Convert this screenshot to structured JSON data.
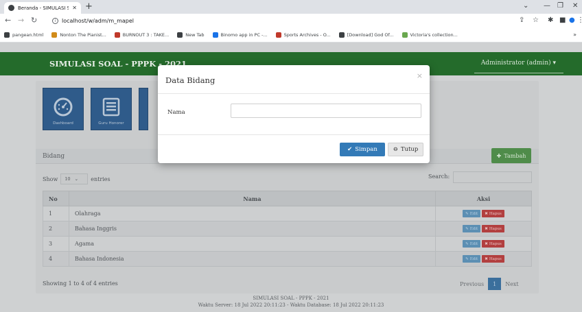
{
  "browser": {
    "tab_title": "Beranda - SIMULASI SOAL - PPPK",
    "new_tab_label": "+",
    "url": "localhost/w/adm/m_mapel",
    "bookmarks": [
      {
        "label": "pangean.html",
        "icon": "globe-icon",
        "color": "#3c4043"
      },
      {
        "label": "Nonton The Pianist...",
        "icon": "film-icon",
        "color": "#d18b1a"
      },
      {
        "label": "BURNOUT 3 : TAKE...",
        "icon": "game-icon",
        "color": "#c0392b"
      },
      {
        "label": "New Tab",
        "icon": "globe-icon",
        "color": "#3c4043"
      },
      {
        "label": "Binomo app in PC -...",
        "icon": "binomo-icon",
        "color": "#1a73e8"
      },
      {
        "label": "Sports Archives - O...",
        "icon": "gamepad-icon",
        "color": "#c0392b"
      },
      {
        "label": "[Download] God Of...",
        "icon": "globe-icon",
        "color": "#3c4043"
      },
      {
        "label": "Victoria's collection...",
        "icon": "leaf-icon",
        "color": "#6aa84f"
      }
    ],
    "more_label": "»"
  },
  "navbar": {
    "brand": "SIMULASI SOAL - PPPK - 2021",
    "user": "Administrator (admin) ▾"
  },
  "quicklinks": [
    {
      "label": "Dashboard",
      "icon": "gauge-icon"
    },
    {
      "label": "Guru Honorer",
      "icon": "list-icon"
    }
  ],
  "panel": {
    "title": "Bidang",
    "add_label": "Tambah"
  },
  "datatable": {
    "show_label": "Show",
    "length_value": "10",
    "entries_label": "entries",
    "search_label": "Search:",
    "headers": {
      "no": "No",
      "nama": "Nama",
      "aksi": "Aksi"
    },
    "rows": [
      {
        "no": "1",
        "nama": "Olahraga"
      },
      {
        "no": "2",
        "nama": "Bahasa Inggris"
      },
      {
        "no": "3",
        "nama": "Agama"
      },
      {
        "no": "4",
        "nama": "Bahasa Indonesia"
      }
    ],
    "edit_label": "Edit",
    "hapus_label": "Hapus",
    "info": "Showing 1 to 4 of 4 entries",
    "prev_label": "Previous",
    "current_page": "1",
    "next_label": "Next"
  },
  "footer": {
    "line1": "SIMULASI SOAL - PPPK - 2021",
    "line2": "Waktu Server: 18 Jul 2022 20:11:23 - Waktu Database: 18 Jul 2022 20:11:23"
  },
  "modal": {
    "title": "Data Bidang",
    "close_label": "×",
    "field_label": "Nama",
    "field_value": "",
    "save_label": "Simpan",
    "close_button_label": "Tutup"
  },
  "colors": {
    "navbar": "#246b2b",
    "primary": "#337ab7",
    "success": "#4f8c4a",
    "danger": "#b23f3f"
  }
}
